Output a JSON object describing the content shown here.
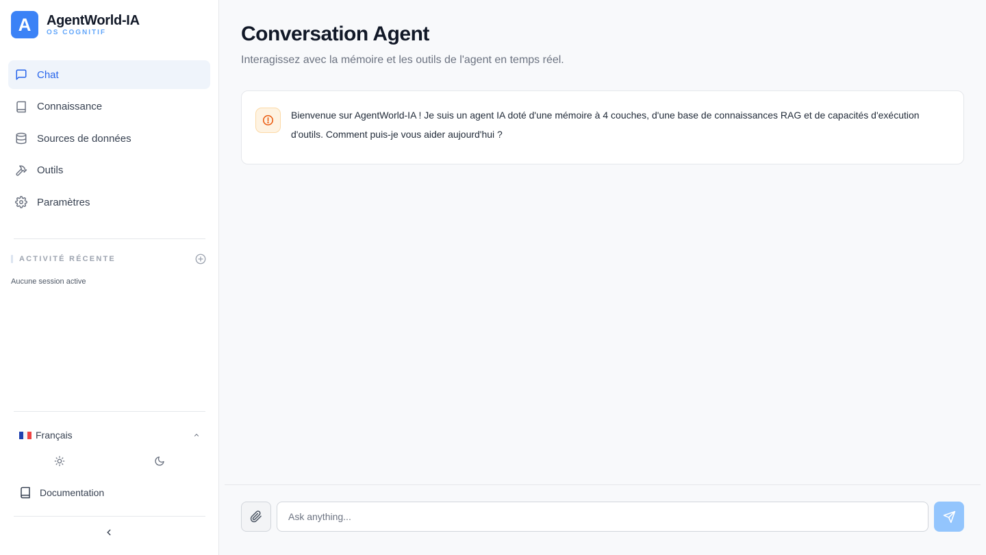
{
  "brand": {
    "logo_letter": "A",
    "name": "AgentWorld-IA",
    "subtitle": "OS COGNITIF",
    "accent": "#3b82f6"
  },
  "nav": {
    "active": "Chat",
    "items": [
      {
        "label": "Chat",
        "icon": "message-square-icon"
      },
      {
        "label": "Connaissance",
        "icon": "book-icon"
      },
      {
        "label": "Sources de données",
        "icon": "database-icon"
      },
      {
        "label": "Outils",
        "icon": "hammer-icon"
      },
      {
        "label": "Paramètres",
        "icon": "gear-icon"
      }
    ]
  },
  "recent": {
    "title": "ACTIVITÉ RÉCENTE",
    "empty": "Aucune session active",
    "add_icon": "plus-circle-icon"
  },
  "footer": {
    "language": "Français",
    "language_flag": [
      "#1e40af",
      "#f3f4f6",
      "#ef4444"
    ],
    "theme_icons": [
      "sun-icon",
      "moon-icon"
    ],
    "docs": "Documentation",
    "collapse_icon": "chevron-left-icon"
  },
  "main": {
    "title": "Conversation Agent",
    "subtitle": "Interagissez avec la mémoire et les outils de l'agent en temps réel.",
    "message": {
      "icon": "alert-circle-icon",
      "text": "Bienvenue sur AgentWorld-IA ! Je suis un agent IA doté d'une mémoire à 4 couches, d'une base de connaissances RAG et de capacités d'exécution d'outils. Comment puis-je vous aider aujourd'hui ?"
    },
    "composer": {
      "placeholder": "Ask anything...",
      "value": "",
      "attach_icon": "paperclip-icon",
      "send_icon": "send-icon"
    }
  }
}
